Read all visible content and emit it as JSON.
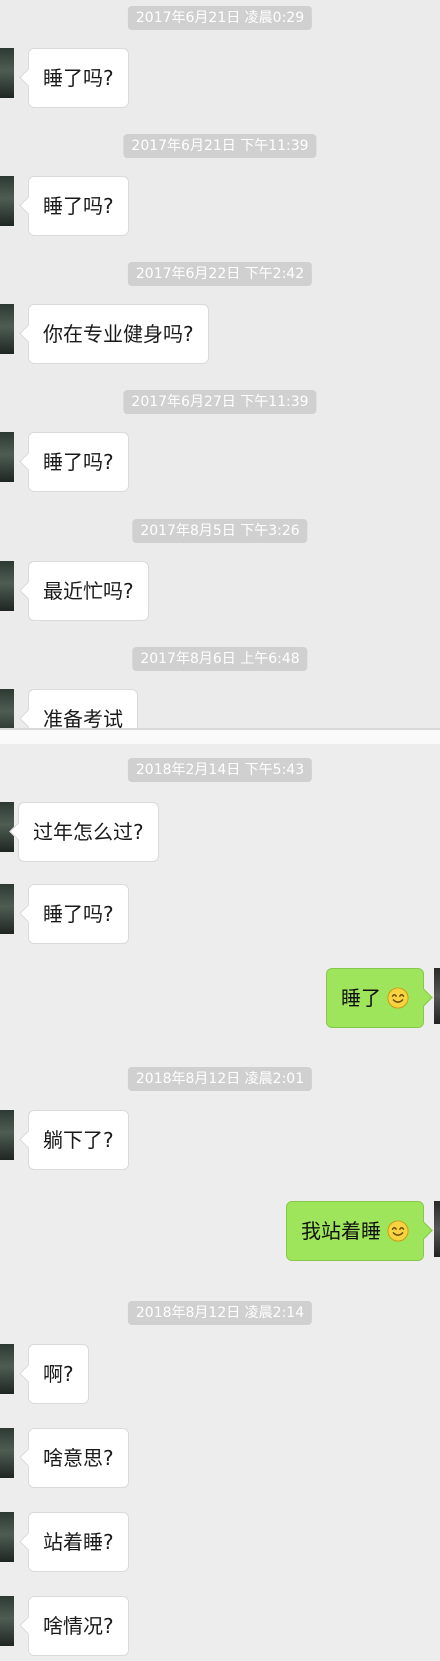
{
  "section1": {
    "messages": [
      {
        "time": "2017年6月21日 凌晨0:29",
        "text": "睡了吗?"
      },
      {
        "time": "2017年6月21日 下午11:39",
        "text": "睡了吗?"
      },
      {
        "time": "2017年6月22日 下午2:42",
        "text": "你在专业健身吗?"
      },
      {
        "time": "2017年6月27日 下午11:39",
        "text": "睡了吗?"
      },
      {
        "time": "2017年8月5日 下午3:26",
        "text": "最近忙吗?"
      },
      {
        "time": "2017年8月6日 上午6:48",
        "text": "准备考试"
      }
    ]
  },
  "section2": {
    "time1": "2018年2月14日 下午5:43",
    "msg1": "过年怎么过?",
    "msg2": "睡了吗?",
    "reply1": "睡了",
    "time2": "2018年8月12日 凌晨2:01",
    "msg3": "躺下了?",
    "reply2": "我站着睡",
    "time3": "2018年8月12日 凌晨2:14",
    "msg4": "啊?",
    "msg5": "啥意思?",
    "msg6": "站着睡?",
    "msg7": "啥情况?"
  },
  "icons": {
    "smile_emoji": "smile-emoji-icon",
    "avatar": "avatar"
  },
  "colors": {
    "background": "#ebebeb",
    "timestamp_bg": "#d0d0d0",
    "incoming_bubble": "#ffffff",
    "outgoing_bubble": "#9fe55c"
  }
}
